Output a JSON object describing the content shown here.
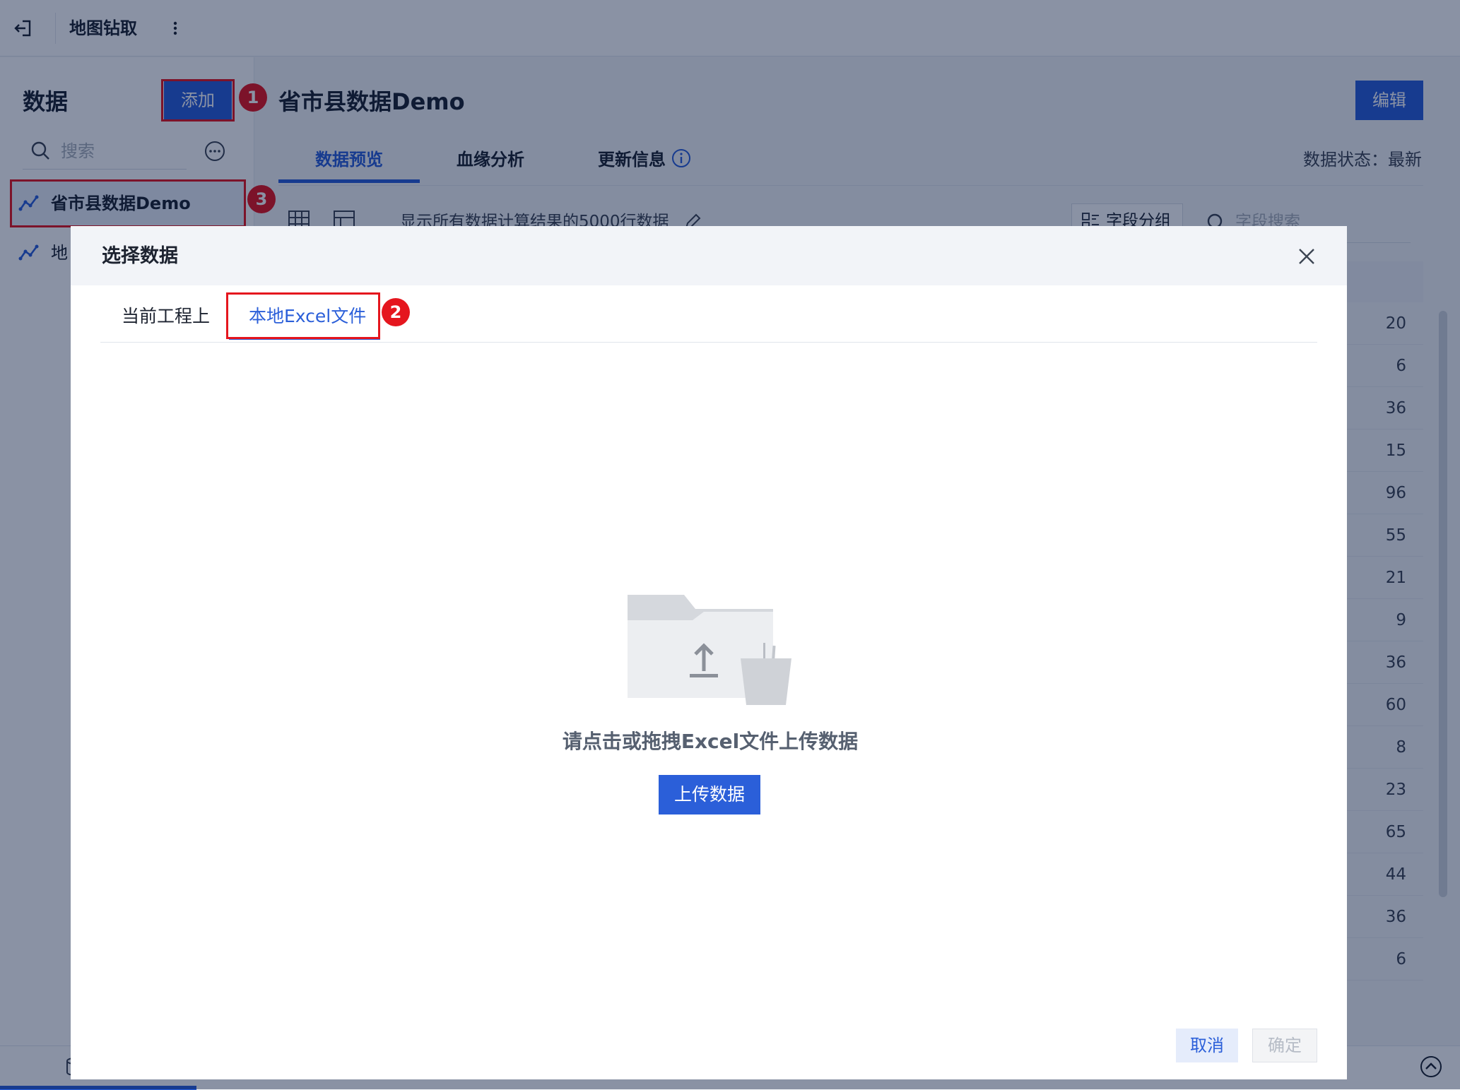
{
  "topbar": {
    "title": "地图钻取"
  },
  "sidebar": {
    "title": "数据",
    "add_label": "添加",
    "search_placeholder": "搜索",
    "items": [
      {
        "label": "省市县数据Demo"
      },
      {
        "label": "地"
      }
    ]
  },
  "main": {
    "title": "省市县数据Demo",
    "edit_label": "编辑",
    "tabs": [
      {
        "label": "数据预览"
      },
      {
        "label": "血缘分析"
      },
      {
        "label": "更新信息"
      }
    ],
    "status": "数据状态：最新",
    "hint": "显示所有数据计算结果的5000行数据",
    "field_group_label": "字段分组",
    "field_search_placeholder": "字段搜索",
    "column_values": [
      "20",
      "6",
      "36",
      "15",
      "96",
      "55",
      "21",
      "9",
      "36",
      "60",
      "8",
      "23",
      "65",
      "44",
      "36",
      "6"
    ]
  },
  "annotations": [
    "1",
    "2",
    "3"
  ],
  "modal": {
    "title": "选择数据",
    "tabs": [
      {
        "label": "当前工程上"
      },
      {
        "label": "本地Excel文件"
      }
    ],
    "upload_text": "请点击或拖拽Excel文件上传数据",
    "upload_label": "上传数据",
    "cancel_label": "取消",
    "ok_label": "确定"
  },
  "colors": {
    "accent": "#2b5fd9",
    "annotation": "#e5161e"
  },
  "icons": [
    "back-icon",
    "more-icon",
    "search-icon",
    "ellipsis-circle-icon",
    "dataset-icon",
    "info-icon",
    "table-view-icon",
    "layout-view-icon",
    "edit-pencil-icon",
    "field-group-icon",
    "close-icon",
    "folder-upload-icon",
    "database-icon",
    "chevron-up-circle-icon"
  ]
}
